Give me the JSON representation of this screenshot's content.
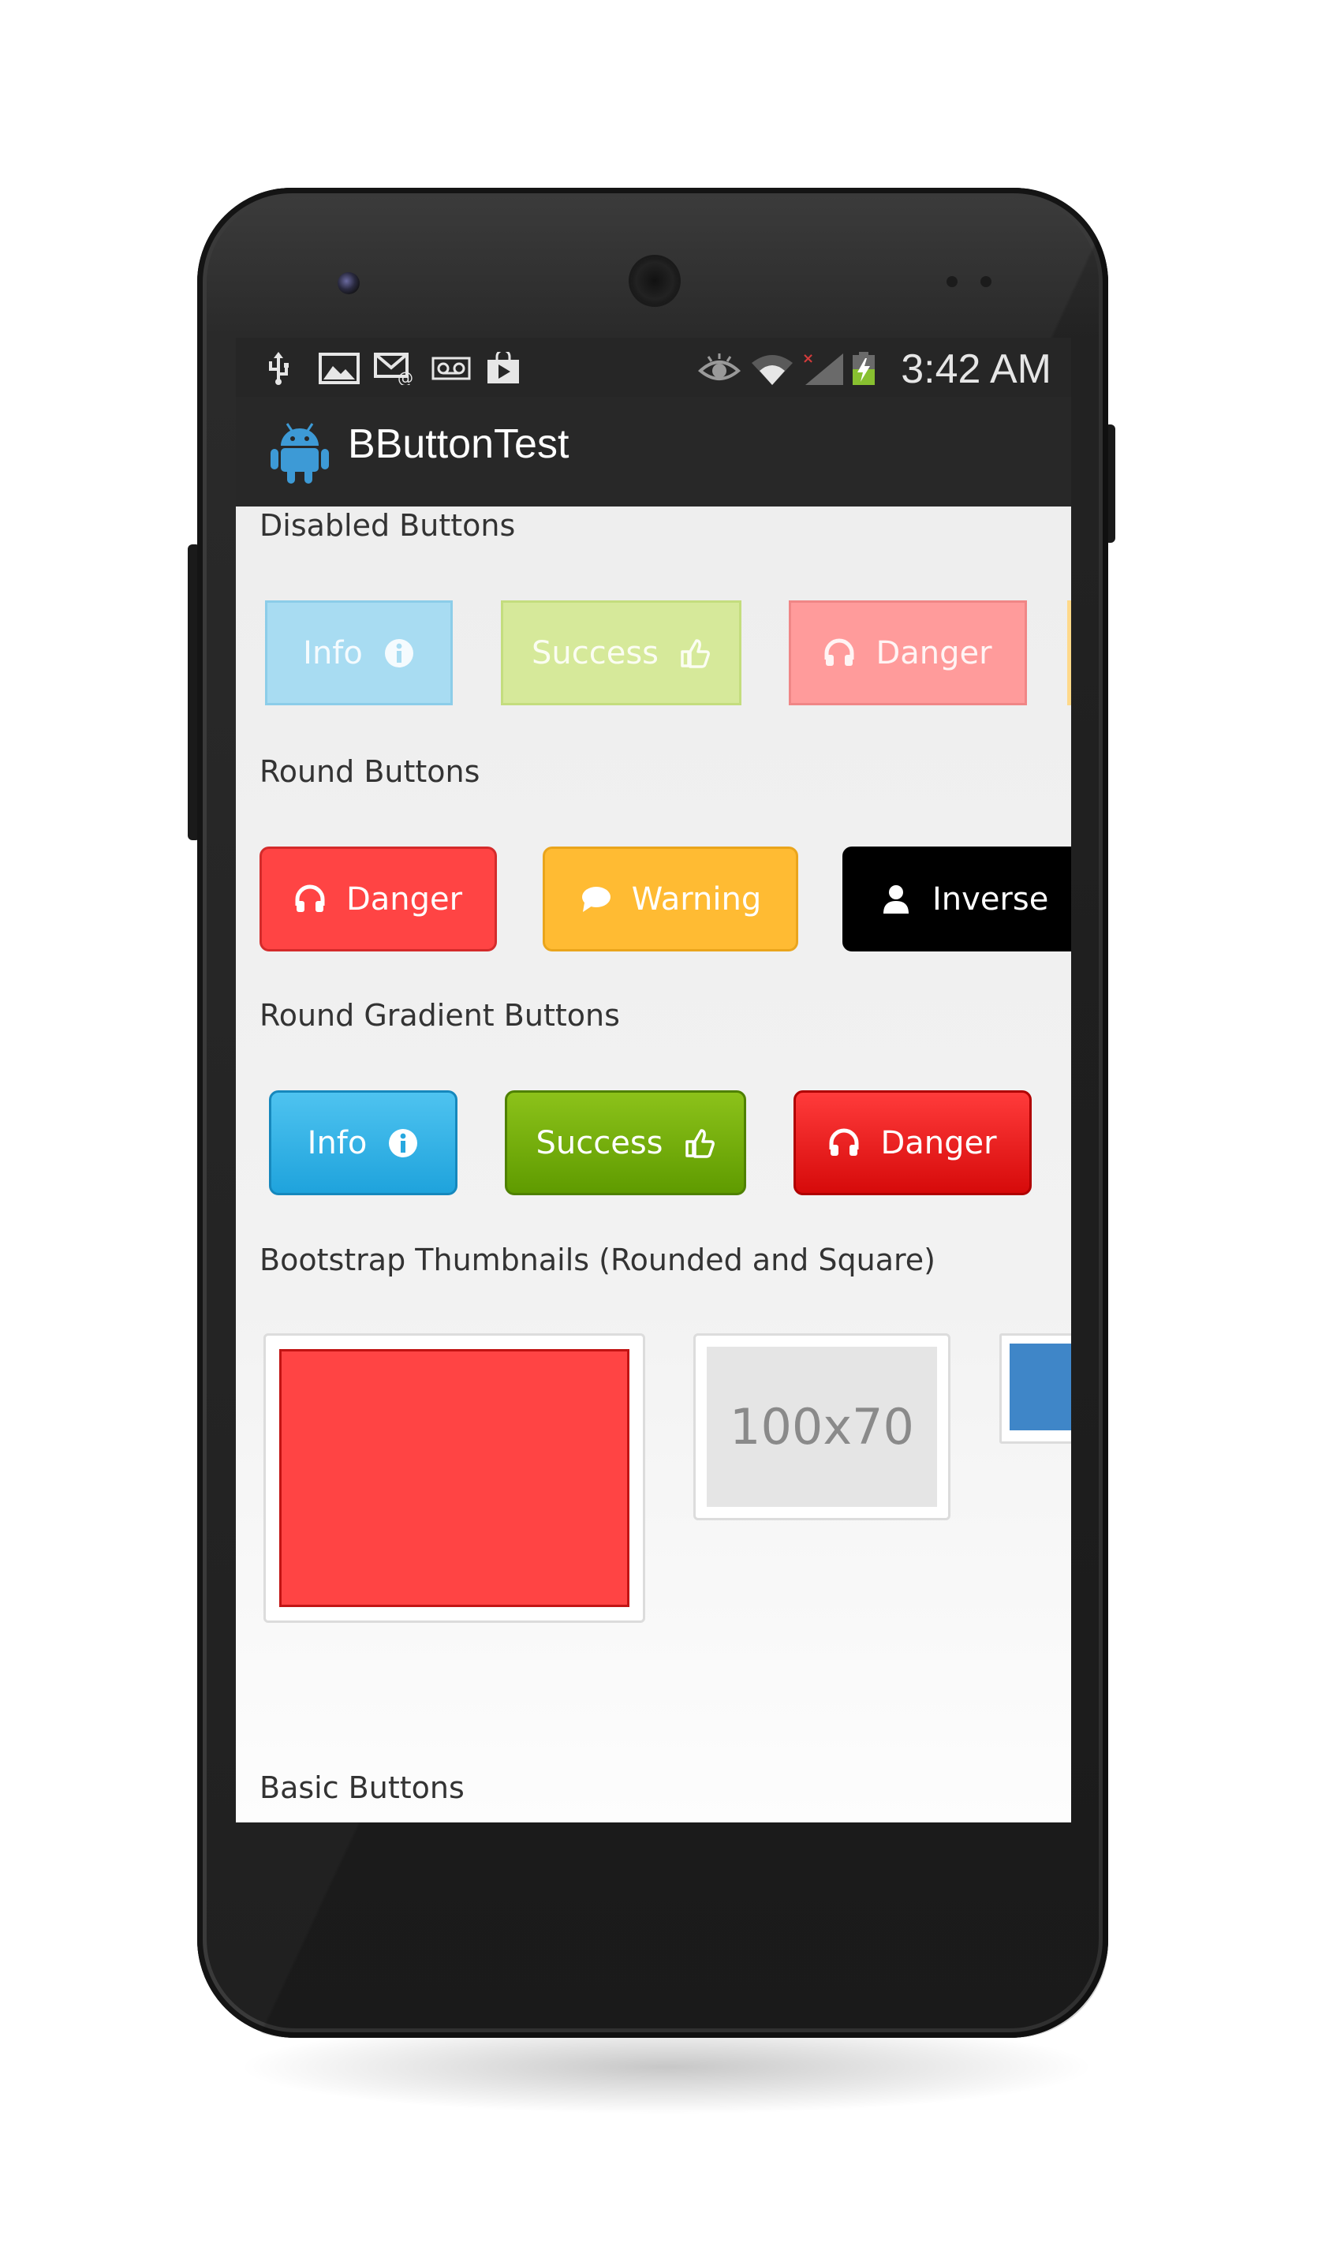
{
  "status_bar": {
    "time": "3:42 AM",
    "left_icons": [
      "usb-icon",
      "image-icon",
      "email-icon",
      "voicemail-icon",
      "play-store-icon"
    ],
    "right_icons": [
      "eye-icon",
      "wifi-icon",
      "signal-no-service-icon",
      "battery-charging-icon"
    ]
  },
  "action_bar": {
    "title": "BButtonTest",
    "app_icon": "android-icon"
  },
  "sections": {
    "disabled": {
      "title": "Disabled Buttons",
      "buttons": [
        {
          "label": "Info",
          "icon": "info-icon",
          "color": "#a8dcf2"
        },
        {
          "label": "Success",
          "icon": "thumbs-up-icon",
          "color": "#d6e99a"
        },
        {
          "label": "Danger",
          "icon": "headphones-icon",
          "color": "#ff9b9b"
        }
      ]
    },
    "round": {
      "title": "Round Buttons",
      "buttons": [
        {
          "label": "Danger",
          "icon": "headphones-icon",
          "color": "#ff4444"
        },
        {
          "label": "Warning",
          "icon": "comment-icon",
          "color": "#ffbb33"
        },
        {
          "label": "Inverse",
          "icon": "user-icon",
          "color": "#000000"
        }
      ]
    },
    "round_gradient": {
      "title": "Round Gradient Buttons",
      "buttons": [
        {
          "label": "Info",
          "icon": "info-icon",
          "color": "#33b5e5"
        },
        {
          "label": "Success",
          "icon": "thumbs-up-icon",
          "color": "#669900"
        },
        {
          "label": "Danger",
          "icon": "headphones-icon",
          "color": "#cc0000"
        }
      ]
    },
    "thumbnails": {
      "title": "Bootstrap Thumbnails (Rounded and Square)",
      "placeholder_label": "100x70",
      "colors": [
        "#ff4444",
        "#e5e5e5",
        "#3f86c8"
      ]
    },
    "basic": {
      "title": "Basic Buttons"
    }
  }
}
